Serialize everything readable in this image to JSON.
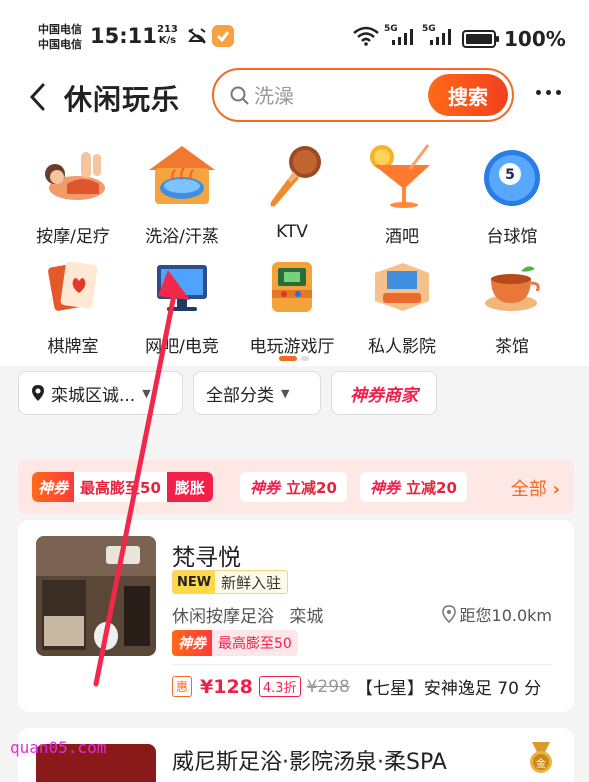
{
  "status": {
    "carrier1": "中国电信",
    "carrier2": "中国电信",
    "time": "15:11",
    "speed_value": "213",
    "speed_unit": "K/s",
    "signal1_label": "5G",
    "signal2_label": "5G",
    "battery": "100%"
  },
  "header": {
    "title": "休闲玩乐",
    "search_placeholder": "洗澡",
    "search_button": "搜索"
  },
  "categories": [
    {
      "label": "按摩/足疗",
      "icon": "massage-icon"
    },
    {
      "label": "洗浴/汗蒸",
      "icon": "bath-icon"
    },
    {
      "label": "KTV",
      "icon": "microphone-icon"
    },
    {
      "label": "酒吧",
      "icon": "cocktail-icon"
    },
    {
      "label": "台球馆",
      "icon": "billiard-ball-icon"
    },
    {
      "label": "棋牌室",
      "icon": "playing-cards-icon"
    },
    {
      "label": "网吧/电竞",
      "icon": "monitor-icon"
    },
    {
      "label": "电玩游戏厅",
      "icon": "arcade-icon"
    },
    {
      "label": "私人影院",
      "icon": "cinema-icon"
    },
    {
      "label": "茶馆",
      "icon": "tea-cup-icon"
    }
  ],
  "filters": {
    "location": "栾城区诚...",
    "category": "全部分类",
    "merchant": "神券商家"
  },
  "promo": {
    "coupon1_tag": "神券",
    "coupon1_text": "最高膨至50",
    "coupon1_swell": "膨胀",
    "coupon2_tag": "神券",
    "coupon2_text": "立减20",
    "coupon3_tag": "神券",
    "coupon3_text": "立减20",
    "all": "全部"
  },
  "shop1": {
    "name": "梵寻悦",
    "new_tag": "NEW",
    "new_text": "新鲜入驻",
    "category": "休闲按摩足浴",
    "area": "栾城",
    "distance": "距您10.0km",
    "coupon_tag": "神券",
    "coupon_text": "最高膨至50",
    "deal_tag": "惠",
    "price": "¥128",
    "discount": "4.3折",
    "original": "¥298",
    "deal_name": "【七星】安神逸足 70 分"
  },
  "shop2": {
    "name": "威尼斯足浴·影院汤泉·柔SPA",
    "medal": "金"
  },
  "watermark": "quan05.com",
  "colors": {
    "accent": "#f36a26",
    "red": "#f0204b"
  }
}
